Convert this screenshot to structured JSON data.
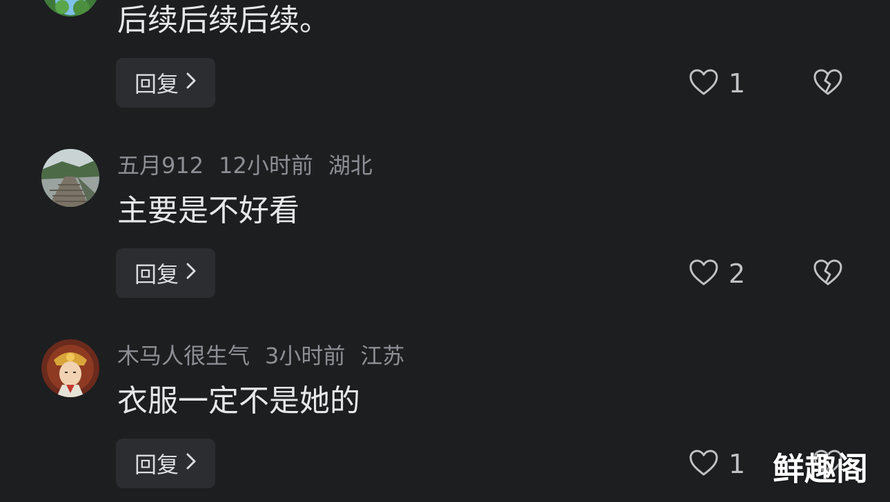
{
  "comments": [
    {
      "username": "",
      "time": "",
      "location": "",
      "text": "后续后续后续。",
      "reply_label": "回复",
      "likes": "1"
    },
    {
      "username": "五月912",
      "time": "12小时前",
      "location": "湖北",
      "text": "主要是不好看",
      "reply_label": "回复",
      "likes": "2"
    },
    {
      "username": "木马人很生气",
      "time": "3小时前",
      "location": "江苏",
      "text": "衣服一定不是她的",
      "reply_label": "回复",
      "likes": "1"
    }
  ],
  "watermark": "鲜趣阁",
  "colors": {
    "background": "#1c1e20",
    "reply_button": "#2b2d30",
    "meta_text": "#8c8f94",
    "body_text": "#e6e7e9"
  },
  "icons": {
    "like": "heart-outline-icon",
    "dislike": "broken-heart-icon",
    "reply_chevron": "chevron-right-icon"
  }
}
